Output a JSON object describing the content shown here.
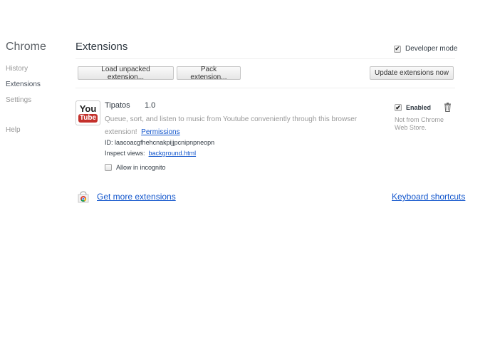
{
  "sidebar": {
    "title": "Chrome",
    "items": [
      {
        "label": "History"
      },
      {
        "label": "Extensions"
      },
      {
        "label": "Settings"
      },
      {
        "label": "Help"
      }
    ]
  },
  "header": {
    "title": "Extensions",
    "developer_mode_label": "Developer mode",
    "developer_mode_checked": true
  },
  "toolbar": {
    "load_unpacked_label": "Load unpacked extension...",
    "pack_label": "Pack extension...",
    "update_label": "Update extensions now"
  },
  "extension": {
    "name": "Tipatos",
    "version": "1.0",
    "description": "Queue, sort, and listen to music from Youtube conveniently through this browser extension!",
    "permissions_label": "Permissions",
    "id_label": "ID:",
    "id_value": "laacoacgfhehcnakpijjpcnipnpneopn",
    "inspect_label": "Inspect views:",
    "inspect_link": "background.html",
    "incognito_label": "Allow in incognito",
    "enabled_label": "Enabled",
    "not_store_text": "Not from Chrome Web Store.",
    "icon_you": "You",
    "icon_tube": "Tube"
  },
  "footer": {
    "get_more_label": "Get more extensions",
    "shortcuts_label": "Keyboard shortcuts"
  },
  "colors": {
    "link": "#1155cc",
    "youtube_red": "#c4302b"
  }
}
